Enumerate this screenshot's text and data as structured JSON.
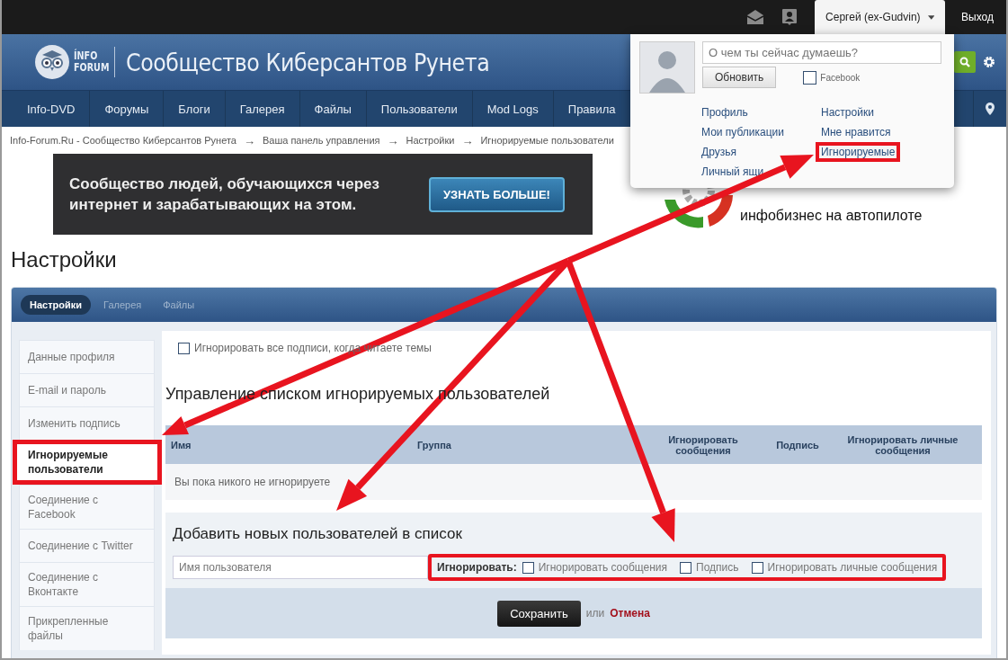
{
  "top_bar": {
    "user_menu": {
      "label": "Сергей (ex-Gudvin)",
      "expanded": true
    },
    "logout": "Выход"
  },
  "header": {
    "logo": {
      "line_1": "ÍNFO",
      "line_2": "FORUM"
    },
    "site_title": "Сообщество Киберсантов Рунета"
  },
  "nav": [
    {
      "label": "Info-DVD"
    },
    {
      "label": "Форумы"
    },
    {
      "label": "Блоги"
    },
    {
      "label": "Галерея"
    },
    {
      "label": "Файлы"
    },
    {
      "label": "Пользователи"
    },
    {
      "label": "Mod Logs"
    },
    {
      "label": "Правила"
    }
  ],
  "breadcrumb": {
    "separator": "→",
    "items": [
      "Info-Forum.Ru - Сообщество Киберсантов Рунета",
      "Ваша панель управления",
      "Настройки",
      "Игнорируемые пользователи"
    ]
  },
  "ad_banner": {
    "text": "Сообщество людей, обучающихся через интернет и зарабатывающих на этом.",
    "button": "УЗНАТЬ БОЛЬШЕ!"
  },
  "partner_logo": {
    "tagline": "инфобизнес на автопилоте"
  },
  "page_title": "Настройки",
  "tabs": [
    {
      "label": "Настройки",
      "selected": true
    },
    {
      "label": "Галерея",
      "selected": false
    },
    {
      "label": "Файлы",
      "selected": false
    }
  ],
  "sidebar": {
    "items": [
      {
        "label": "Данные профиля",
        "selected": false,
        "highlighted": false
      },
      {
        "label": "E-mail и пароль",
        "selected": false,
        "highlighted": false
      },
      {
        "label": "Изменить подпись",
        "selected": false,
        "highlighted": false
      },
      {
        "label": "Игнорируемые пользователи",
        "selected": true,
        "highlighted": true
      },
      {
        "label": "Соединение с Facebook",
        "selected": false,
        "highlighted": false
      },
      {
        "label": "Соединение с Twitter",
        "selected": false,
        "highlighted": false
      },
      {
        "label": "Соединение с Вконтакте",
        "selected": false,
        "highlighted": false
      },
      {
        "label": "Прикрепленные файлы",
        "selected": false,
        "highlighted": false
      }
    ]
  },
  "ignore_signatures": {
    "label": "Игнорировать все подписи, когда читаете темы",
    "checked": false
  },
  "ignore_list": {
    "title": "Управление списком игнорируемых пользователей",
    "columns": [
      "Имя",
      "Группа",
      "Игнорировать сообщения",
      "Подпись",
      "Игнорировать личные сообщения"
    ],
    "empty_message": "Вы пока никого не игнорируете"
  },
  "add_users": {
    "title": "Добавить новых пользователей в список",
    "username_field": {
      "placeholder": "Имя пользователя"
    },
    "ignore_label": "Игнорировать:",
    "highlighted": true,
    "options": [
      {
        "label": "Игнорировать сообщения",
        "checked": false
      },
      {
        "label": "Подпись",
        "checked": false
      },
      {
        "label": "Игнорировать личные сообщения",
        "checked": false
      }
    ]
  },
  "actions": {
    "save": "Сохранить",
    "or": "или",
    "cancel": "Отмена"
  },
  "user_dropdown": {
    "status_field": {
      "placeholder": "О чем ты сейчас думаешь?"
    },
    "update_button": "Обновить",
    "facebook": {
      "label": "Facebook",
      "checked": false
    },
    "link_columns": [
      {
        "links": [
          {
            "label": "Профиль",
            "highlighted": false
          },
          {
            "label": "Мои публикации",
            "highlighted": false
          },
          {
            "label": "Друзья",
            "highlighted": false
          },
          {
            "label": "Личный ящи",
            "highlighted": false
          }
        ]
      },
      {
        "links": [
          {
            "label": "Настройки",
            "highlighted": false
          },
          {
            "label": "Мне нравится",
            "highlighted": false
          },
          {
            "label": "Игнорируемые",
            "highlighted": true
          }
        ]
      }
    ]
  }
}
